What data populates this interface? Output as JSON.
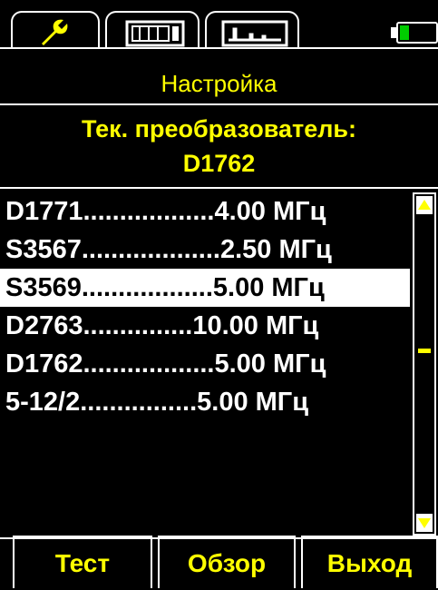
{
  "tabs": [
    {
      "icon": "wrench-icon",
      "active": true
    },
    {
      "icon": "numeric-display-icon",
      "active": false
    },
    {
      "icon": "waveform-icon",
      "active": false
    }
  ],
  "battery": {
    "icon": "battery-icon",
    "level": 0.25,
    "color": "#00cc00"
  },
  "title": "Настройка",
  "current": {
    "label": "Тек. преобразователь:",
    "value": "D1762"
  },
  "transducers": [
    {
      "text": "D1771..................4.00 МГц",
      "selected": false
    },
    {
      "text": "S3567...................2.50 МГц",
      "selected": false
    },
    {
      "text": "S3569..................5.00 МГц",
      "selected": true
    },
    {
      "text": "D2763...............10.00 МГц",
      "selected": false
    },
    {
      "text": "D1762..................5.00 МГц",
      "selected": false
    },
    {
      "text": "5-12/2................5.00 МГц",
      "selected": false
    }
  ],
  "scrollbar": {
    "position": 0.45
  },
  "buttons": {
    "test": "Тест",
    "browse": "Обзор",
    "exit": "Выход"
  },
  "colors": {
    "accent": "#ffff00",
    "background": "#000000",
    "text": "#ffffff"
  }
}
